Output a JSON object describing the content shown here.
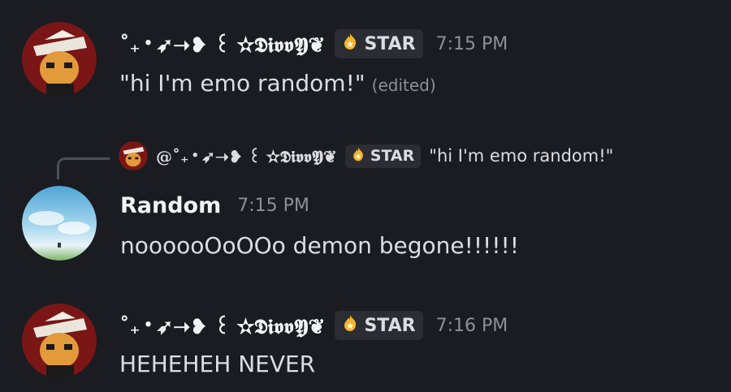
{
  "messages": [
    {
      "username": "˚₊‧➶➝❥ ꒰ ✫𝕯𝖎𝖛𝖛𝖄❦",
      "tag": "STAR",
      "time": "7:15 PM",
      "content": "\"hi I'm emo random!\"",
      "edited": "(edited)"
    },
    {
      "reply": {
        "username": "@˚₊‧➶➝❥ ꒰ ✫𝕯𝖎𝖛𝖛𝖄❦",
        "tag": "STAR",
        "content": "\"hi I'm emo random!\""
      },
      "username": "Random",
      "time": "7:15 PM",
      "content": "noooooOoOOo demon begone!!!!!!"
    },
    {
      "username": "˚₊‧➶➝❥ ꒰ ✫𝕯𝖎𝖛𝖛𝖄❦",
      "tag": "STAR",
      "time": "7:16 PM",
      "content": "HEHEHEH NEVER"
    }
  ],
  "colors": {
    "background": "#1b1c21",
    "tag_background": "#2b2d33",
    "timestamp": "#8e9096",
    "text": "#dbdee1"
  },
  "icons": {
    "tag": "flame-star-icon",
    "avatar1": "anime-character-avatar",
    "avatar2": "sky-landscape-avatar"
  }
}
